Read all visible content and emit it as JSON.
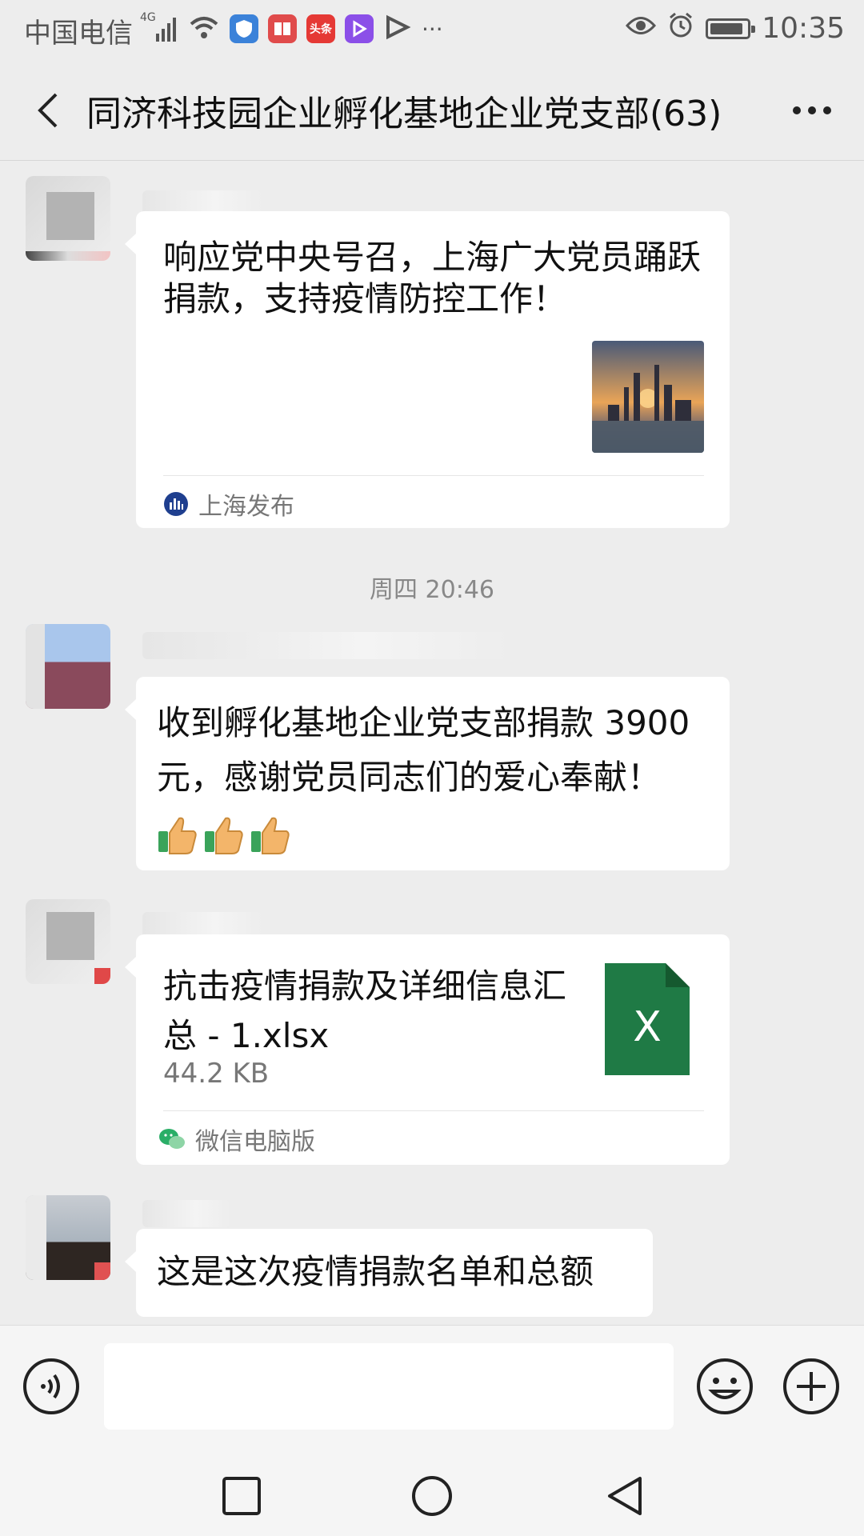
{
  "status_bar": {
    "carrier": "中国电信",
    "signal_label": "4G",
    "news_badge": "头条",
    "time": "10:35",
    "battery_level": 0.8
  },
  "header": {
    "title": "同济科技园企业孵化基地企业党支部(63)"
  },
  "messages": {
    "article": {
      "title": "响应党中央号召，上海广大党员踊跃捐款，支持疫情防控工作！",
      "source": "上海发布"
    },
    "timestamp": "周四 20:46",
    "donation": {
      "text": "收到孵化基地企业党支部捐款 3900元，感谢党员同志们的爱心奉献！",
      "emoji": [
        "thumbs-up",
        "thumbs-up",
        "thumbs-up"
      ]
    },
    "file": {
      "name": "抗击疫情捐款及详细信息汇总 - 1.xlsx",
      "size": "44.2 KB",
      "icon_letter": "X",
      "source": "微信电脑版"
    },
    "last": {
      "text": "这是这次疫情捐款名单和总额"
    }
  },
  "colors": {
    "background": "#ededed",
    "bubble": "#ffffff",
    "excel_green": "#1f7a45",
    "wechat_green": "#2aae67"
  },
  "nav": {
    "icons": [
      "recent-apps-icon",
      "home-icon",
      "back-icon"
    ]
  }
}
